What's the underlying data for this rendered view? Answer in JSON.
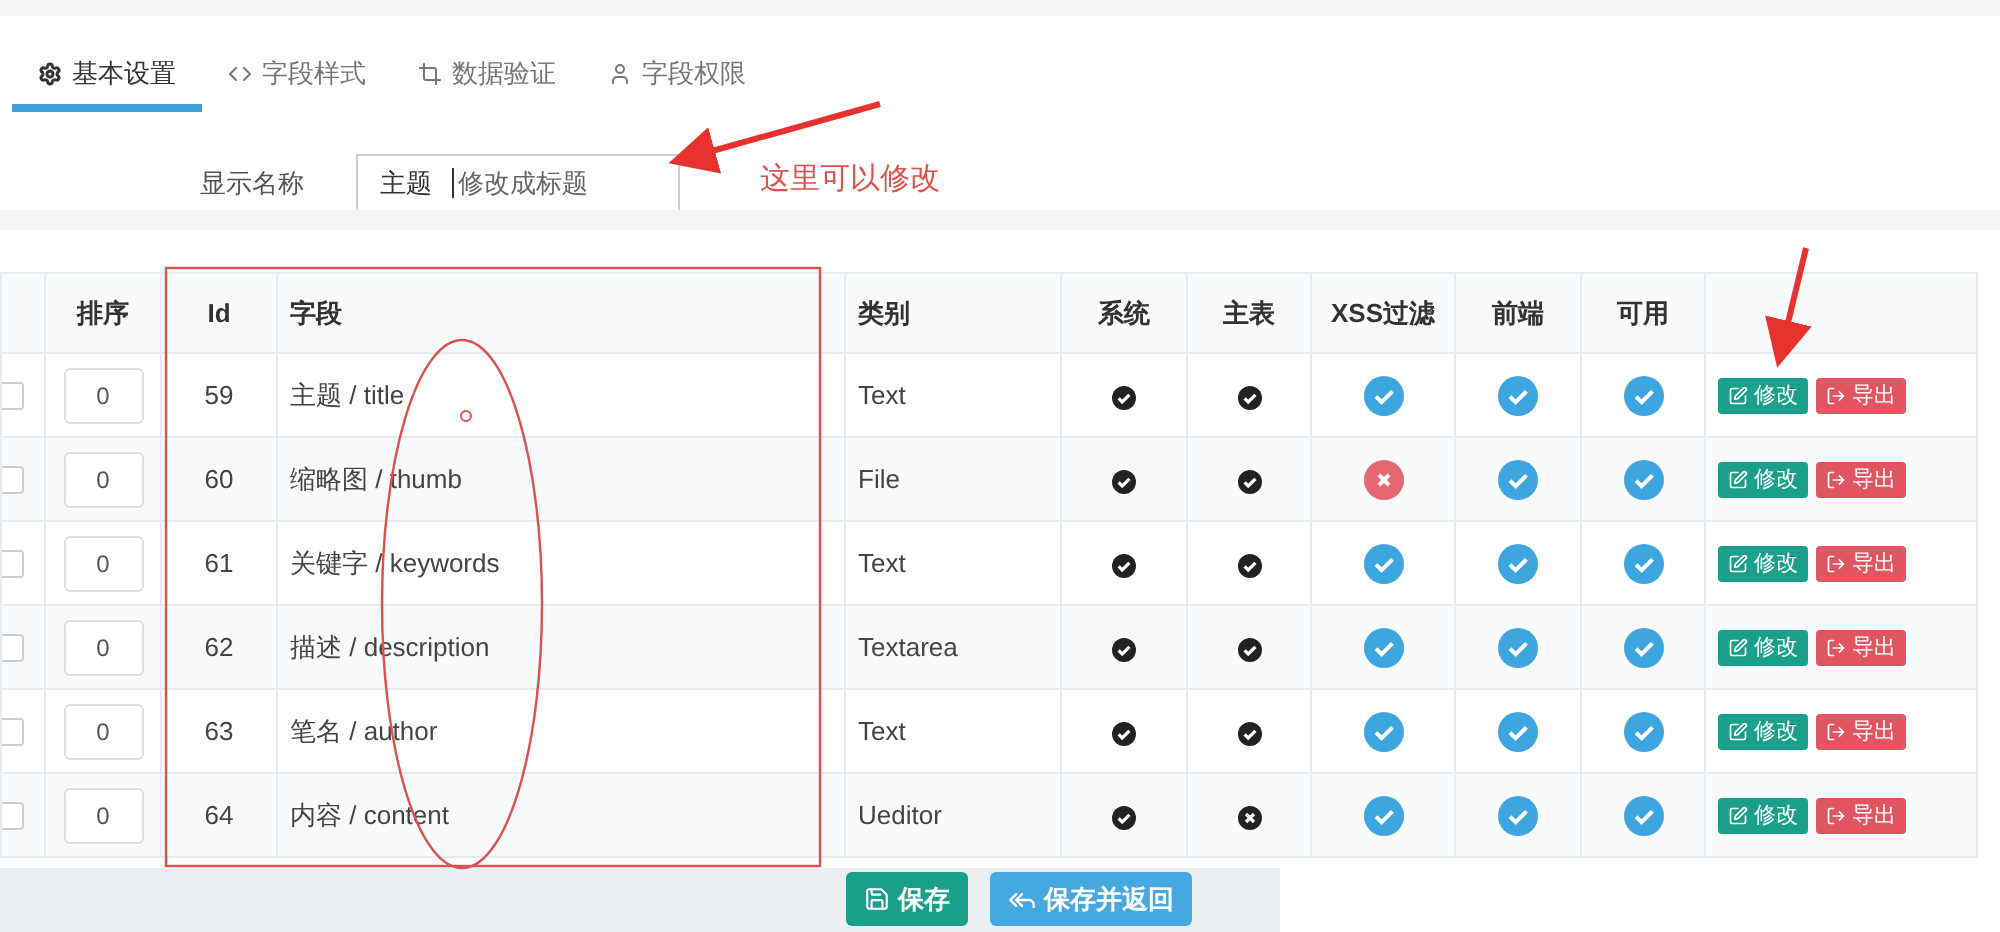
{
  "tabs": [
    {
      "label": "基本设置",
      "selected": true
    },
    {
      "label": "字段样式",
      "selected": false
    },
    {
      "label": "数据验证",
      "selected": false
    },
    {
      "label": "字段权限",
      "selected": false
    }
  ],
  "display_name": {
    "label": "显示名称",
    "value": "主题",
    "hint": "修改成标题"
  },
  "annotation": {
    "note": "这里可以修改"
  },
  "table": {
    "columns": [
      "排序",
      "Id",
      "字段",
      "类别",
      "系统",
      "主表",
      "XSS过滤",
      "前端",
      "可用"
    ],
    "rows": [
      {
        "checked": false,
        "order": "0",
        "id": "59",
        "field": "主题 / title",
        "type": "Text",
        "system": true,
        "main": true,
        "xss": true,
        "frontend": true,
        "enabled": true,
        "actions": [
          "修改",
          "导出"
        ]
      },
      {
        "checked": false,
        "order": "0",
        "id": "60",
        "field": "缩略图 / thumb",
        "type": "File",
        "system": true,
        "main": true,
        "xss": false,
        "frontend": true,
        "enabled": true,
        "actions": [
          "修改",
          "导出"
        ]
      },
      {
        "checked": false,
        "order": "0",
        "id": "61",
        "field": "关键字 / keywords",
        "type": "Text",
        "system": true,
        "main": true,
        "xss": true,
        "frontend": true,
        "enabled": true,
        "actions": [
          "修改",
          "导出"
        ]
      },
      {
        "checked": false,
        "order": "0",
        "id": "62",
        "field": "描述 / description",
        "type": "Textarea",
        "system": true,
        "main": true,
        "xss": true,
        "frontend": true,
        "enabled": true,
        "actions": [
          "修改",
          "导出"
        ]
      },
      {
        "checked": false,
        "order": "0",
        "id": "63",
        "field": "笔名 / author",
        "type": "Text",
        "system": true,
        "main": true,
        "xss": true,
        "frontend": true,
        "enabled": true,
        "actions": [
          "修改",
          "导出"
        ]
      },
      {
        "checked": false,
        "order": "0",
        "id": "64",
        "field": "内容 / content",
        "type": "Ueditor",
        "system": true,
        "main": false,
        "xss": true,
        "frontend": true,
        "enabled": true,
        "actions": [
          "修改",
          "导出"
        ]
      }
    ]
  },
  "buttons": [
    {
      "label": "保存",
      "kind": "save"
    },
    {
      "label": "保存并返回",
      "kind": "back"
    }
  ]
}
